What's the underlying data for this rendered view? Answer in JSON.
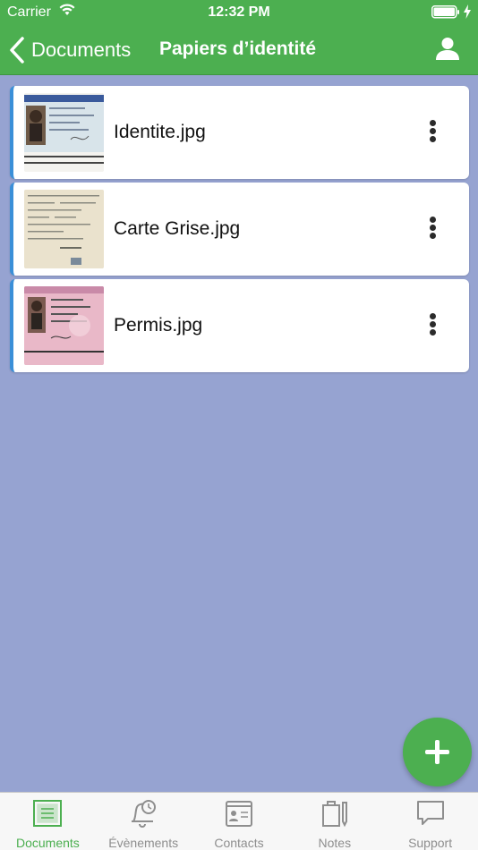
{
  "status": {
    "carrier": "Carrier",
    "time": "12:32 PM"
  },
  "nav": {
    "back_label": "Documents",
    "title": "Papiers d’identité"
  },
  "documents": [
    {
      "name": "Identite.jpg"
    },
    {
      "name": "Carte Grise.jpg"
    },
    {
      "name": "Permis.jpg"
    }
  ],
  "tabs": [
    {
      "label": "Documents",
      "icon": "documents-icon",
      "active": true
    },
    {
      "label": "Évènements",
      "icon": "bell-clock-icon",
      "active": false
    },
    {
      "label": "Contacts",
      "icon": "contact-card-icon",
      "active": false
    },
    {
      "label": "Notes",
      "icon": "notes-icon",
      "active": false
    },
    {
      "label": "Support",
      "icon": "chat-bubble-icon",
      "active": false
    }
  ],
  "colors": {
    "primary": "#4caf50",
    "background": "#96a3d1",
    "card_accent": "#3a8fd8"
  }
}
